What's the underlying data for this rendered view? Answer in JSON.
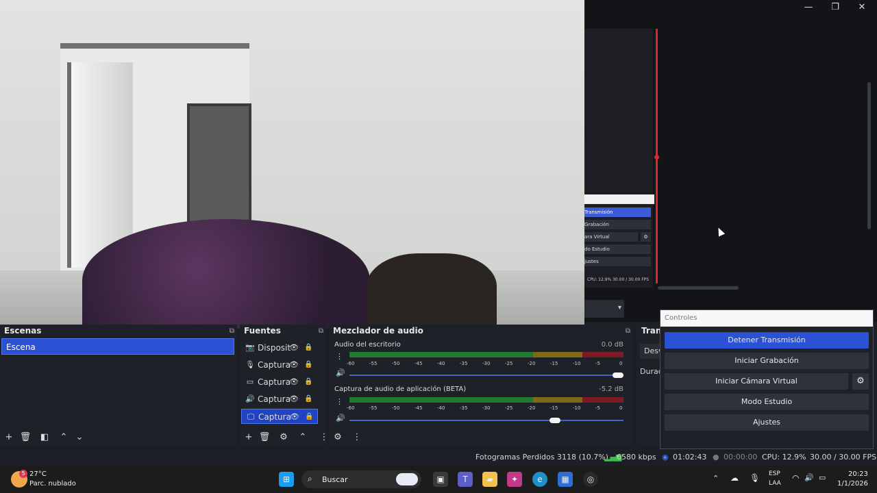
{
  "window": {
    "minimize": "—",
    "restore": "❐",
    "close": "✕"
  },
  "nested_preview": {
    "buttons": [
      "Transmisión",
      "Grabación",
      "ara Virtual",
      "do Estudio",
      "justes"
    ],
    "gear": "⚙",
    "status": "CPU: 12.9%   30.00 / 30.00 FPS"
  },
  "scenes": {
    "title": "Escenas",
    "items": [
      "Escena"
    ]
  },
  "sources": {
    "title": "Fuentes",
    "items": [
      {
        "icon": "camera-icon",
        "glyph": "📷",
        "label": "Disposit"
      },
      {
        "icon": "microphone-icon",
        "glyph": "🎙",
        "label": "Captura"
      },
      {
        "icon": "window-icon",
        "glyph": "▭",
        "label": "Captura"
      },
      {
        "icon": "speaker-capture-icon",
        "glyph": "🔊",
        "label": "Captura"
      },
      {
        "icon": "monitor-icon",
        "glyph": "🖵",
        "label": "Captura"
      }
    ]
  },
  "mixer": {
    "title": "Mezclador de audio",
    "ticks": [
      "-60",
      "-55",
      "-50",
      "-45",
      "-40",
      "-35",
      "-30",
      "-25",
      "-20",
      "-15",
      "-10",
      "-5",
      "0"
    ],
    "channels": [
      {
        "name": "Audio del escritorio",
        "db": "0.0 dB",
        "volume": 1.0
      },
      {
        "name": "Captura de audio de aplicación (BETA)",
        "db": "-5.2 dB",
        "volume": 0.77
      }
    ]
  },
  "transitions": {
    "title": "Trans",
    "field": "Desv",
    "duration_label": "Durac"
  },
  "controls": {
    "title": "Controles",
    "stop_stream": "Detener Transmisión",
    "start_recording": "Iniciar Grabación",
    "start_virtual_cam": "Iniciar Cámara Virtual",
    "studio_mode": "Modo Estudio",
    "settings": "Ajustes",
    "gear": "⚙"
  },
  "status": {
    "dropped_frames": "Fotogramas Perdidos 3118 (10.7%)",
    "bitrate": "6580 kbps",
    "stream_time": "01:02:43",
    "record_time": "00:00:00",
    "cpu": "CPU: 12.9%",
    "fps": "30.00 / 30.00 FPS"
  },
  "taskbar": {
    "weather_temp": "27°C",
    "weather_desc": "Parc. nublado",
    "weather_badge": "5",
    "search_placeholder": "Buscar",
    "lang_top": "ESP",
    "lang_bottom": "LAA",
    "time": "20:23",
    "date": "1/1/2026"
  },
  "colors": {
    "accent": "#2b52d4",
    "live": "#e0232f"
  }
}
